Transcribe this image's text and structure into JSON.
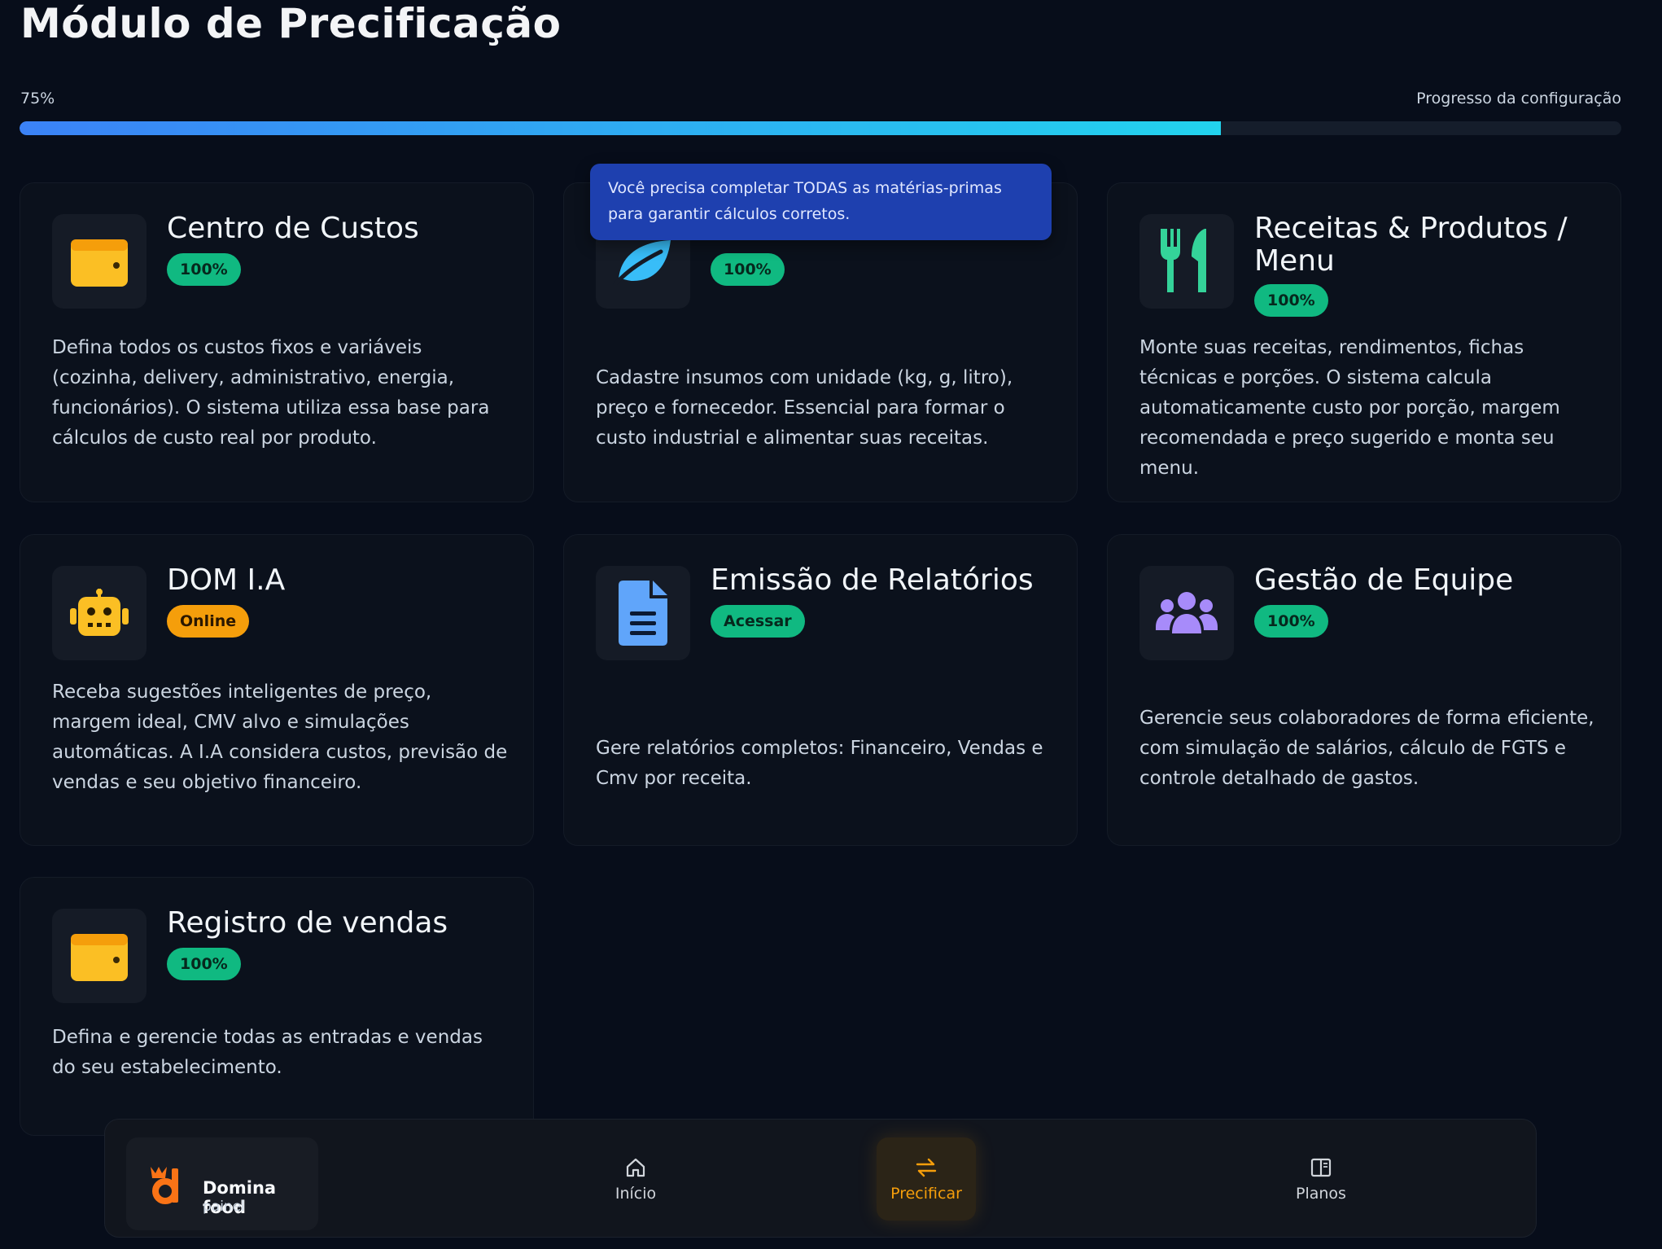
{
  "header": {
    "title": "Módulo de Precificação",
    "progress_value": "75%",
    "progress_fraction": 0.75,
    "progress_label": "Progresso da configuração"
  },
  "tooltip": {
    "text": "Você precisa completar TODAS as matérias-primas para garantir cálculos corretos."
  },
  "cards": [
    {
      "title": "Centro de Custos",
      "badge": "100%",
      "icon": "wallet-icon",
      "description": "Defina todos os custos fixos e variáveis (cozinha, delivery, administrativo, energia, funcionários). O sistema utiliza essa base para cálculos de custo real por produto."
    },
    {
      "title": "",
      "badge": "100%",
      "icon": "leaf-icon",
      "description": "Cadastre insumos com unidade (kg, g, litro), preço e fornecedor. Essencial para formar o custo industrial e alimentar suas receitas."
    },
    {
      "title": "Receitas & Produtos / Menu",
      "badge": "100%",
      "icon": "utensils-icon",
      "description": "Monte suas receitas, rendimentos, fichas técnicas e porções. O sistema calcula automaticamente custo por porção, margem recomendada e preço sugerido e monta seu menu."
    },
    {
      "title": "DOM I.A",
      "badge": "Online",
      "icon": "robot-icon",
      "description": "Receba sugestões inteligentes de preço, margem ideal, CMV alvo e simulações automáticas. A I.A considera custos, previsão de vendas e seu objetivo financeiro."
    },
    {
      "title": "Emissão de Relatórios",
      "badge": "Acessar",
      "icon": "document-icon",
      "description": "Gere relatórios completos: Financeiro, Vendas e Cmv por receita."
    },
    {
      "title": "Gestão de Equipe",
      "badge": "100%",
      "icon": "users-icon",
      "description": "Gerencie seus colaboradores de forma eficiente, com simulação de salários, cálculo de FGTS e controle detalhado de gastos."
    },
    {
      "title": "Registro de vendas",
      "badge": "100%",
      "icon": "wallet-icon",
      "description": "Defina e gerencie todas as entradas e vendas do seu estabelecimento."
    }
  ],
  "nav": {
    "brand_name": "Domina food",
    "brand_sub": "painel",
    "items": [
      {
        "label": "Início",
        "icon": "home-icon"
      },
      {
        "label": "Precificar",
        "icon": "swap-icon"
      },
      {
        "label": "Planos",
        "icon": "book-icon"
      }
    ]
  },
  "colors": {
    "accent_green": "#10b981",
    "accent_orange": "#f59e0b",
    "accent_blue": "#3b82f6",
    "tooltip_blue": "#1e40af",
    "background": "#070d1a"
  }
}
